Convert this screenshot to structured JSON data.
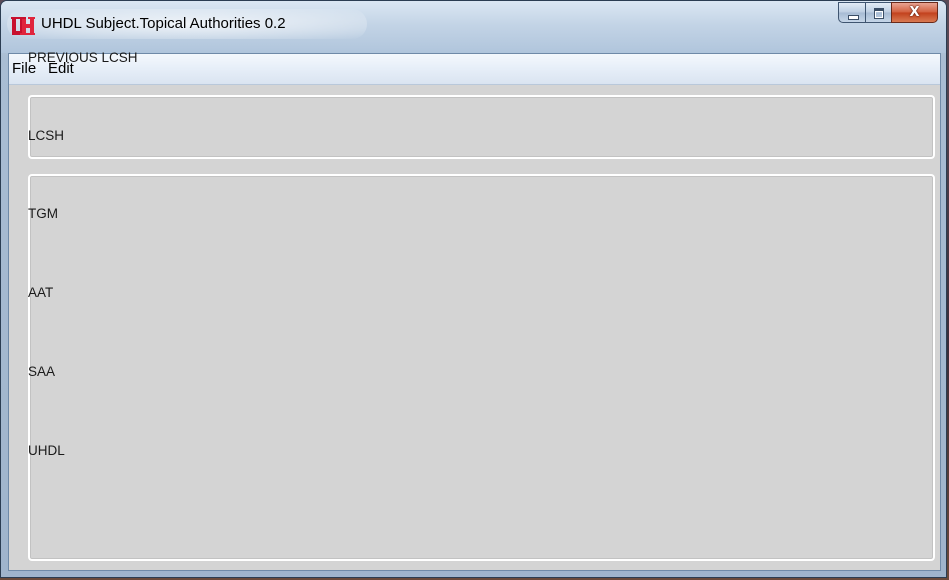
{
  "window": {
    "title": "UHDL Subject.Topical Authorities 0.2",
    "icon": "uh-logo-icon",
    "accent_color": "#cc0000"
  },
  "caption_buttons": {
    "minimize_icon": "minimize-icon",
    "maximize_icon": "maximize-icon",
    "close_label": "X"
  },
  "menu": {
    "items": [
      {
        "label": "File"
      },
      {
        "label": "Edit"
      }
    ]
  },
  "panels": {
    "previous": {
      "label": "PREVIOUS LCSH"
    },
    "authorities": [
      {
        "label": "LCSH"
      },
      {
        "label": "TGM"
      },
      {
        "label": "AAT"
      },
      {
        "label": "SAA"
      },
      {
        "label": "UHDL"
      }
    ]
  }
}
